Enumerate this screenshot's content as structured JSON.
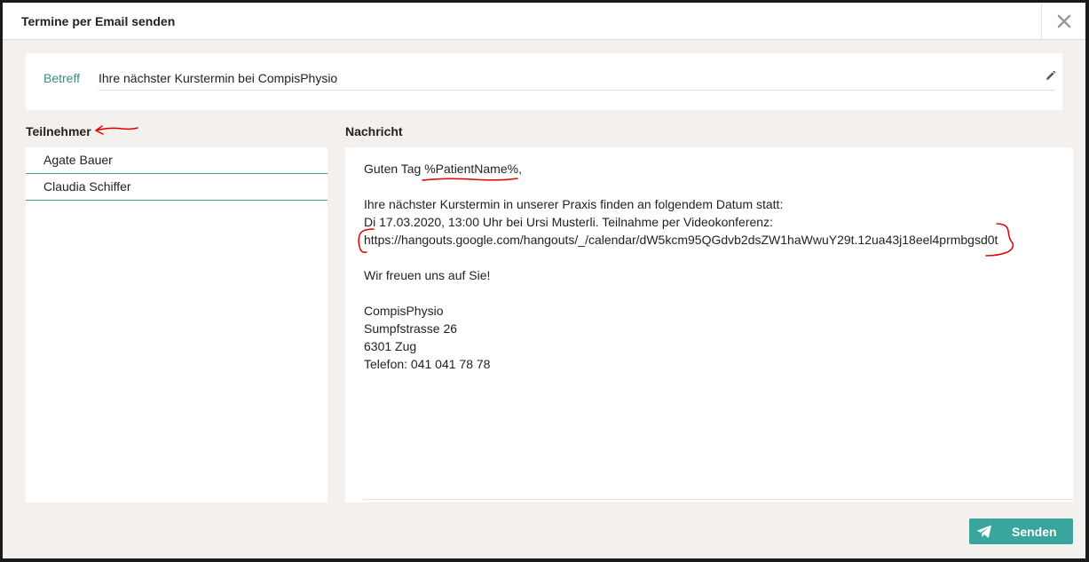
{
  "dialog": {
    "title": "Termine per Email senden",
    "close_icon": "close-icon"
  },
  "subject": {
    "label": "Betreff",
    "value": "Ihre nächster Kurstermin bei CompisPhysio",
    "edit_icon": "pencil-icon"
  },
  "participants": {
    "heading": "Teilnehmer",
    "items": [
      {
        "name": "Agate Bauer"
      },
      {
        "name": "Claudia Schiffer"
      }
    ]
  },
  "message": {
    "heading": "Nachricht",
    "lines": [
      "Guten Tag %PatientName%,",
      "",
      "Ihre nächster Kurstermin in unserer Praxis finden an folgendem Datum statt:",
      "Di 17.03.2020, 13:00 Uhr bei Ursi Musterli. Teilnahme per Videokonferenz:",
      "https://hangouts.google.com/hangouts/_/calendar/dW5kcm95QGdvb2dsZW1haWwuY29t.12ua43j18eel4prmbgsd0t",
      "",
      "Wir freuen uns auf Sie!",
      "",
      "CompisPhysio",
      "Sumpfstrasse 26",
      "6301 Zug",
      "Telefon: 041 041 78 78"
    ]
  },
  "send_button": {
    "label": "Senden",
    "icon": "paper-plane-icon"
  },
  "colors": {
    "accent": "#3aa59c",
    "label_teal": "#3d8d88",
    "annotation_red": "#e00000",
    "background": "#f3f0ed"
  }
}
